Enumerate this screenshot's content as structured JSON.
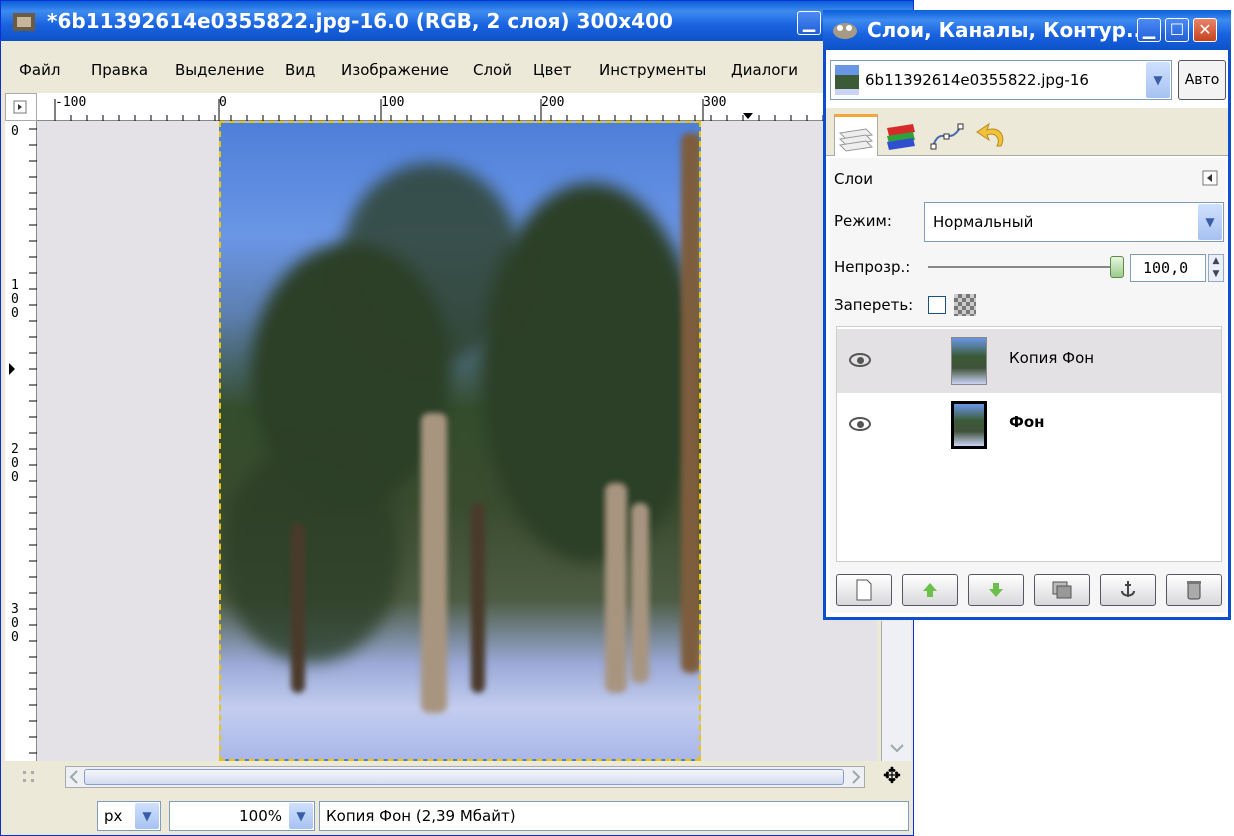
{
  "main_window": {
    "title": "*6b11392614e0355822.jpg-16.0 (RGB, 2 слоя) 300x400",
    "menu": [
      "Файл",
      "Правка",
      "Выделение",
      "Вид",
      "Изображение",
      "Слой",
      "Цвет",
      "Инструменты",
      "Диалоги"
    ],
    "ruler_h_labels": [
      "-100",
      "0",
      "100",
      "200",
      "300"
    ],
    "ruler_v_labels": [
      "0",
      "1\n0\n0",
      "2\n0\n0",
      "3\n0\n0"
    ],
    "status": {
      "unit": "px",
      "zoom": "100%",
      "layer_info": "Копия Фон (2,39 Мбайт)"
    }
  },
  "dock": {
    "title": "Слои, Каналы, Контур...",
    "image_selector": "6b11392614e0355822.jpg-16",
    "auto_button": "Авто",
    "tabs": [
      "layers-tab-icon",
      "channels-tab-icon",
      "paths-tab-icon",
      "undo-tab-icon"
    ],
    "layers_label": "Слои",
    "mode_label": "Режим:",
    "mode_value": "Нормальный",
    "opacity_label": "Непрозр.:",
    "opacity_value": "100,0",
    "opacity_percent": 100,
    "lock_label": "Запереть:",
    "layers": [
      {
        "name": "Копия Фон",
        "selected": true,
        "visible": true
      },
      {
        "name": "Фон",
        "selected": false,
        "visible": true
      }
    ],
    "buttons": [
      "new-layer-icon",
      "raise-layer-icon",
      "lower-layer-icon",
      "duplicate-layer-icon",
      "anchor-layer-icon",
      "delete-layer-icon"
    ]
  }
}
